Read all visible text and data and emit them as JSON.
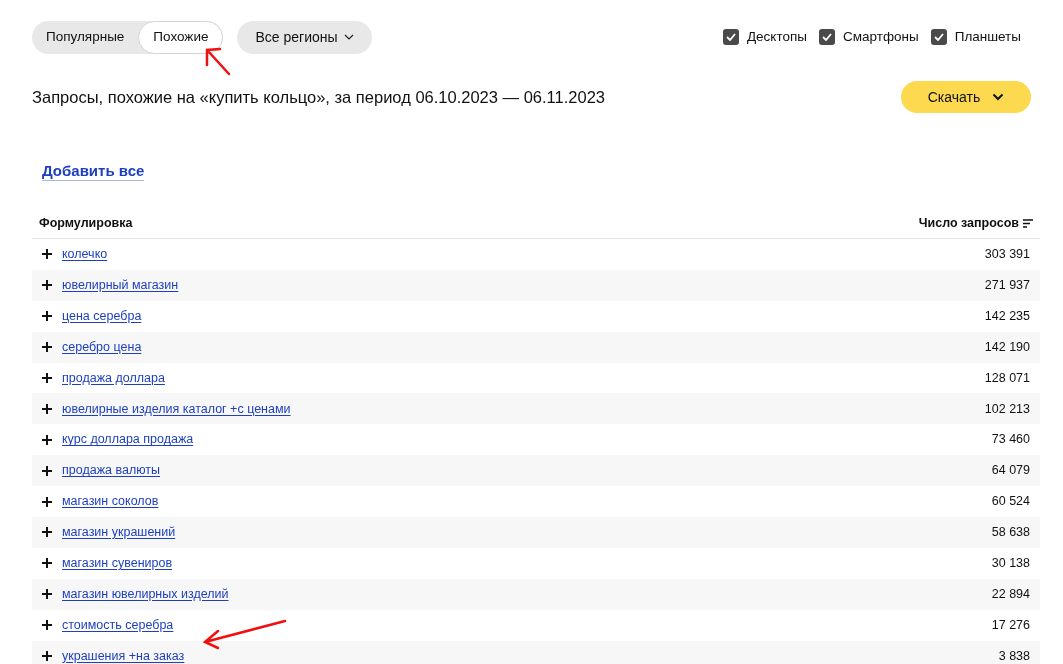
{
  "mode_tabs": [
    {
      "label": "Популярные",
      "selected": false
    },
    {
      "label": "Похожие",
      "selected": true
    }
  ],
  "region_button": "Все регионы",
  "devices": [
    {
      "label": "Десктопы",
      "checked": true
    },
    {
      "label": "Смартфоны",
      "checked": true
    },
    {
      "label": "Планшеты",
      "checked": true
    }
  ],
  "title": "Запросы, похожие на «купить кольцо», за период 06.10.2023 — 06.11.2023",
  "download_button": "Скачать",
  "add_all": "Добавить все",
  "table": {
    "columns": [
      "Формулировка",
      "Число запросов"
    ],
    "rows": [
      {
        "phrase": "колечко",
        "count": "303 391"
      },
      {
        "phrase": "ювелирный магазин",
        "count": "271 937"
      },
      {
        "phrase": "цена серебра",
        "count": "142 235"
      },
      {
        "phrase": "серебро цена",
        "count": "142 190"
      },
      {
        "phrase": "продажа доллара",
        "count": "128 071"
      },
      {
        "phrase": "ювелирные изделия каталог +с ценами",
        "count": "102 213"
      },
      {
        "phrase": "курс доллара продажа",
        "count": "73 460"
      },
      {
        "phrase": "продажа валюты",
        "count": "64 079"
      },
      {
        "phrase": "магазин соколов",
        "count": "60 524"
      },
      {
        "phrase": "магазин украшений",
        "count": "58 638"
      },
      {
        "phrase": "магазин сувениров",
        "count": "30 138"
      },
      {
        "phrase": "магазин ювелирных изделий",
        "count": "22 894"
      },
      {
        "phrase": "стоимость серебра",
        "count": "17 276"
      },
      {
        "phrase": "украшения +на заказ",
        "count": "3 838"
      }
    ]
  }
}
